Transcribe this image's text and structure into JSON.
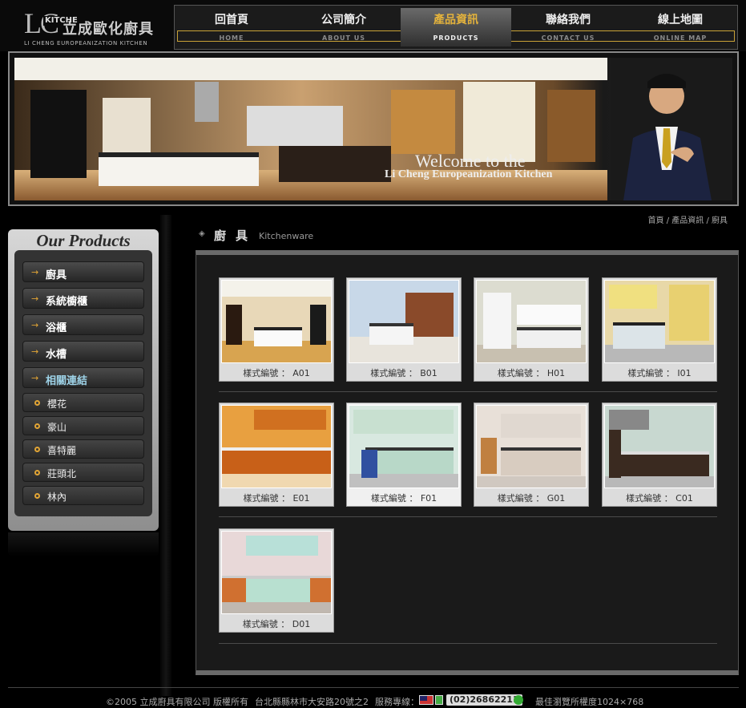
{
  "logo": {
    "mark": "LC",
    "kitche": "KITCHE",
    "name_cn": "立成歐化廚具",
    "name_en": "LI CHENG EUROPEANIZATION KITCHEN"
  },
  "nav": [
    {
      "cn": "回首頁",
      "en": "HOME"
    },
    {
      "cn": "公司簡介",
      "en": "ABOUT US"
    },
    {
      "cn": "產品資訊",
      "en": "PRODUCTS",
      "active": true
    },
    {
      "cn": "聯絡我們",
      "en": "CONTACT US"
    },
    {
      "cn": "線上地圖",
      "en": "ONLINE MAP"
    }
  ],
  "banner": {
    "title1": "Welcome to the",
    "title2": "Li Cheng Europeanization Kitchen"
  },
  "sidebar": {
    "title": "Our Products",
    "items": [
      {
        "label": "廚具"
      },
      {
        "label": "系統櫥櫃"
      },
      {
        "label": "浴櫃"
      },
      {
        "label": "水槽"
      },
      {
        "label": "相關連結"
      }
    ],
    "sub_items": [
      {
        "label": "櫻花"
      },
      {
        "label": "豪山"
      },
      {
        "label": "喜特麗"
      },
      {
        "label": "莊頭北"
      },
      {
        "label": "林內"
      }
    ]
  },
  "breadcrumb": "首頁 / 產品資訊 / 廚具",
  "section": {
    "title": "廚具",
    "subtitle": "Kitchenware"
  },
  "products": [
    {
      "label": "樣式編號 ： A01"
    },
    {
      "label": "樣式編號 ： B01"
    },
    {
      "label": "樣式編號 ： H01"
    },
    {
      "label": "樣式編號 ： I01"
    },
    {
      "label": "樣式編號 ： E01"
    },
    {
      "label": "樣式編號 ： F01"
    },
    {
      "label": "樣式編號 ： G01"
    },
    {
      "label": "樣式編號 ： C01"
    },
    {
      "label": "樣式編號 ： D01"
    }
  ],
  "footer": {
    "copyright": "©2005 立成廚具有限公司 版權所有",
    "address": "台北縣縣林市大安路20號之2",
    "service_label": "服務專線：",
    "phone": "(02)26862211",
    "resolution": "最佳瀏覽所權度1024×768"
  },
  "colors": {
    "accent": "#e2a535",
    "background": "#000000",
    "highlight_link": "#9ed3e8"
  }
}
